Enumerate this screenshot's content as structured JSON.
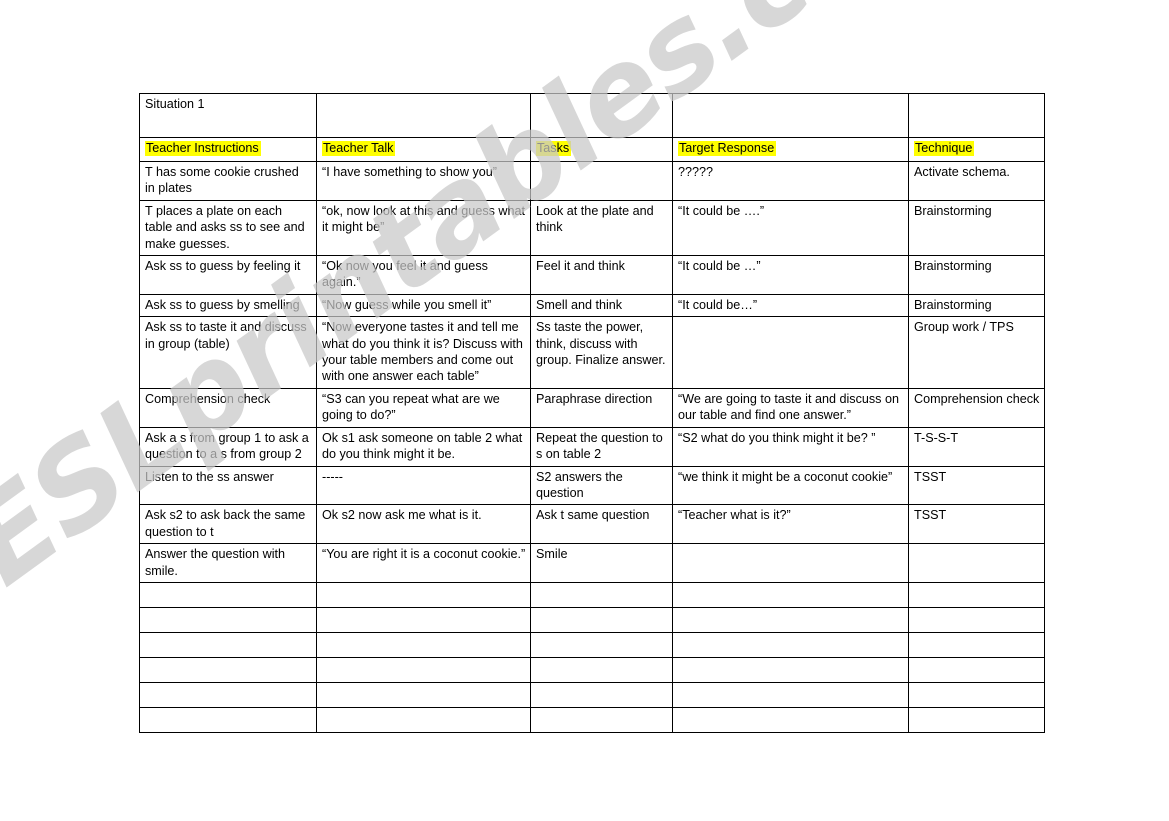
{
  "watermark": {
    "text": "ESLprintables.com",
    "color": "#c9c9c9"
  },
  "highlight_color": "#ffff00",
  "table": {
    "situation_label": "Situation 1",
    "headers": [
      "Teacher Instructions",
      "Teacher Talk",
      "Tasks",
      "Target Response",
      "Technique"
    ],
    "rows": [
      {
        "teacher_instructions": "T has some cookie crushed in plates",
        "teacher_talk": "“I have something to show you”",
        "tasks": "",
        "target_response": "?????",
        "technique": "Activate schema."
      },
      {
        "teacher_instructions": "T places a plate on each table and asks ss to see and make guesses.",
        "teacher_talk": "“ok, now look at this and guess what it might be”",
        "tasks": "Look at the plate and think",
        "target_response": "“It could be ….”",
        "technique": "Brainstorming"
      },
      {
        "teacher_instructions": "Ask ss to guess by feeling it",
        "teacher_talk": "“Ok now you feel it and guess again.”",
        "tasks": "Feel it and think",
        "target_response": "“It could be  …”",
        "technique": "Brainstorming"
      },
      {
        "teacher_instructions": "Ask ss to guess by smelling",
        "teacher_talk": "“Now guess while you smell it”",
        "tasks": "Smell and think",
        "target_response": "“It could be…”",
        "technique": "Brainstorming"
      },
      {
        "teacher_instructions": "Ask ss to taste it and discuss in group (table)",
        "teacher_talk": "“Now everyone tastes it and tell me what do you think it is? Discuss with your table members and come out with one answer each table”",
        "tasks": "Ss taste the power, think, discuss with group. Finalize answer.",
        "target_response": "",
        "technique": "Group work  / TPS"
      },
      {
        "teacher_instructions": "Comprehension check",
        "teacher_talk": "“S3 can you repeat what are we going to do?”",
        "tasks": "Paraphrase direction",
        "target_response": "“We are going to taste it and discuss on our table and find one answer.”",
        "technique": "Comprehension check"
      },
      {
        "teacher_instructions": "Ask a s from group 1 to ask a question to a s from group 2",
        "teacher_talk": "Ok s1 ask someone on table 2 what do you think might it be.",
        "tasks": "Repeat the question to s on table 2",
        "target_response": "“S2 what do you think might it be? ”",
        "technique": "T-S-S-T"
      },
      {
        "teacher_instructions": "Listen to the ss answer",
        "teacher_talk": "-----",
        "tasks": "S2 answers the question",
        "target_response": "“we think it might be a coconut cookie”",
        "technique": "TSST"
      },
      {
        "teacher_instructions": "Ask s2 to ask back the same question to t",
        "teacher_talk": "Ok s2 now ask me what is it.",
        "tasks": "Ask t same question",
        "target_response": "“Teacher what is it?”",
        "technique": "TSST"
      },
      {
        "teacher_instructions": "Answer the question with smile.",
        "teacher_talk": "“You are right it is a coconut cookie.”",
        "tasks": "Smile",
        "target_response": "",
        "technique": ""
      }
    ],
    "empty_row_count": 6
  }
}
